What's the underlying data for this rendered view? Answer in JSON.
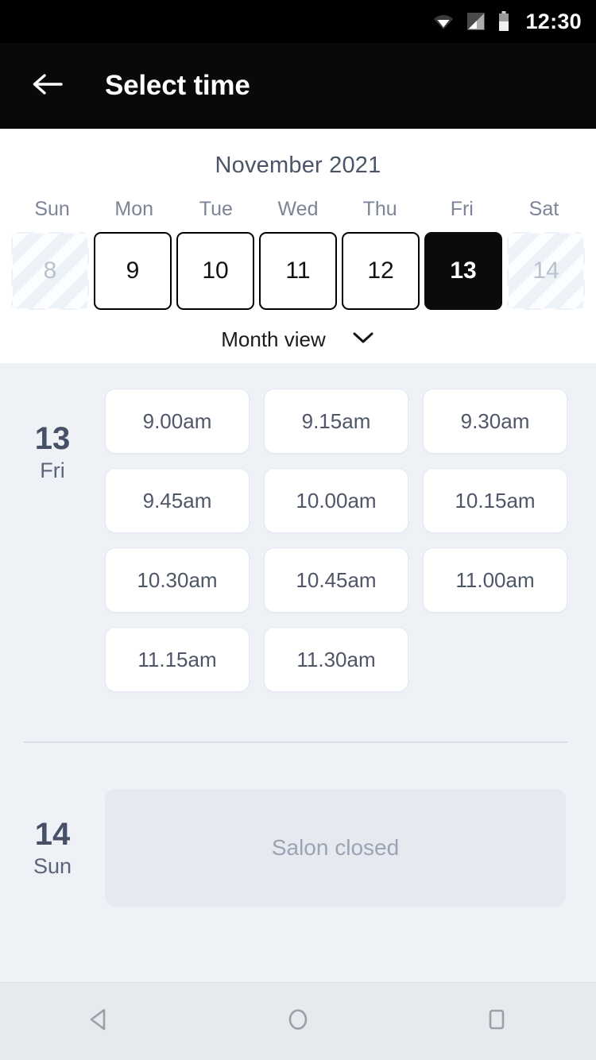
{
  "status_bar": {
    "time": "12:30",
    "icons": [
      "wifi-icon",
      "signal-icon",
      "battery-icon"
    ]
  },
  "app_bar": {
    "back_icon": "back-arrow-icon",
    "title": "Select time"
  },
  "calendar": {
    "month_label": "November 2021",
    "weekdays": [
      "Sun",
      "Mon",
      "Tue",
      "Wed",
      "Thu",
      "Fri",
      "Sat"
    ],
    "days": [
      {
        "num": "8",
        "state": "disabled"
      },
      {
        "num": "9",
        "state": "enabled"
      },
      {
        "num": "10",
        "state": "enabled"
      },
      {
        "num": "11",
        "state": "enabled"
      },
      {
        "num": "12",
        "state": "enabled"
      },
      {
        "num": "13",
        "state": "selected"
      },
      {
        "num": "14",
        "state": "disabled"
      }
    ],
    "view_toggle": {
      "label": "Month view",
      "icon": "chevron-down-icon"
    }
  },
  "schedule": {
    "days": [
      {
        "day_num": "13",
        "day_of_week": "Fri",
        "status": "open",
        "slots": [
          "9.00am",
          "9.15am",
          "9.30am",
          "9.45am",
          "10.00am",
          "10.15am",
          "10.30am",
          "10.45am",
          "11.00am",
          "11.15am",
          "11.30am"
        ]
      },
      {
        "day_num": "14",
        "day_of_week": "Sun",
        "status": "closed",
        "closed_label": "Salon closed",
        "slots": []
      }
    ]
  },
  "nav_bar": {
    "buttons": [
      "back-triangle-icon",
      "home-circle-icon",
      "recents-square-icon"
    ]
  },
  "colors": {
    "appbar_bg": "#090909",
    "page_bg": "#eef2f7",
    "accent_text": "#4a5568",
    "selected_day_bg": "#0b0b0b",
    "slot_bg": "#ffffff",
    "closed_bg": "#e6eaf0"
  }
}
